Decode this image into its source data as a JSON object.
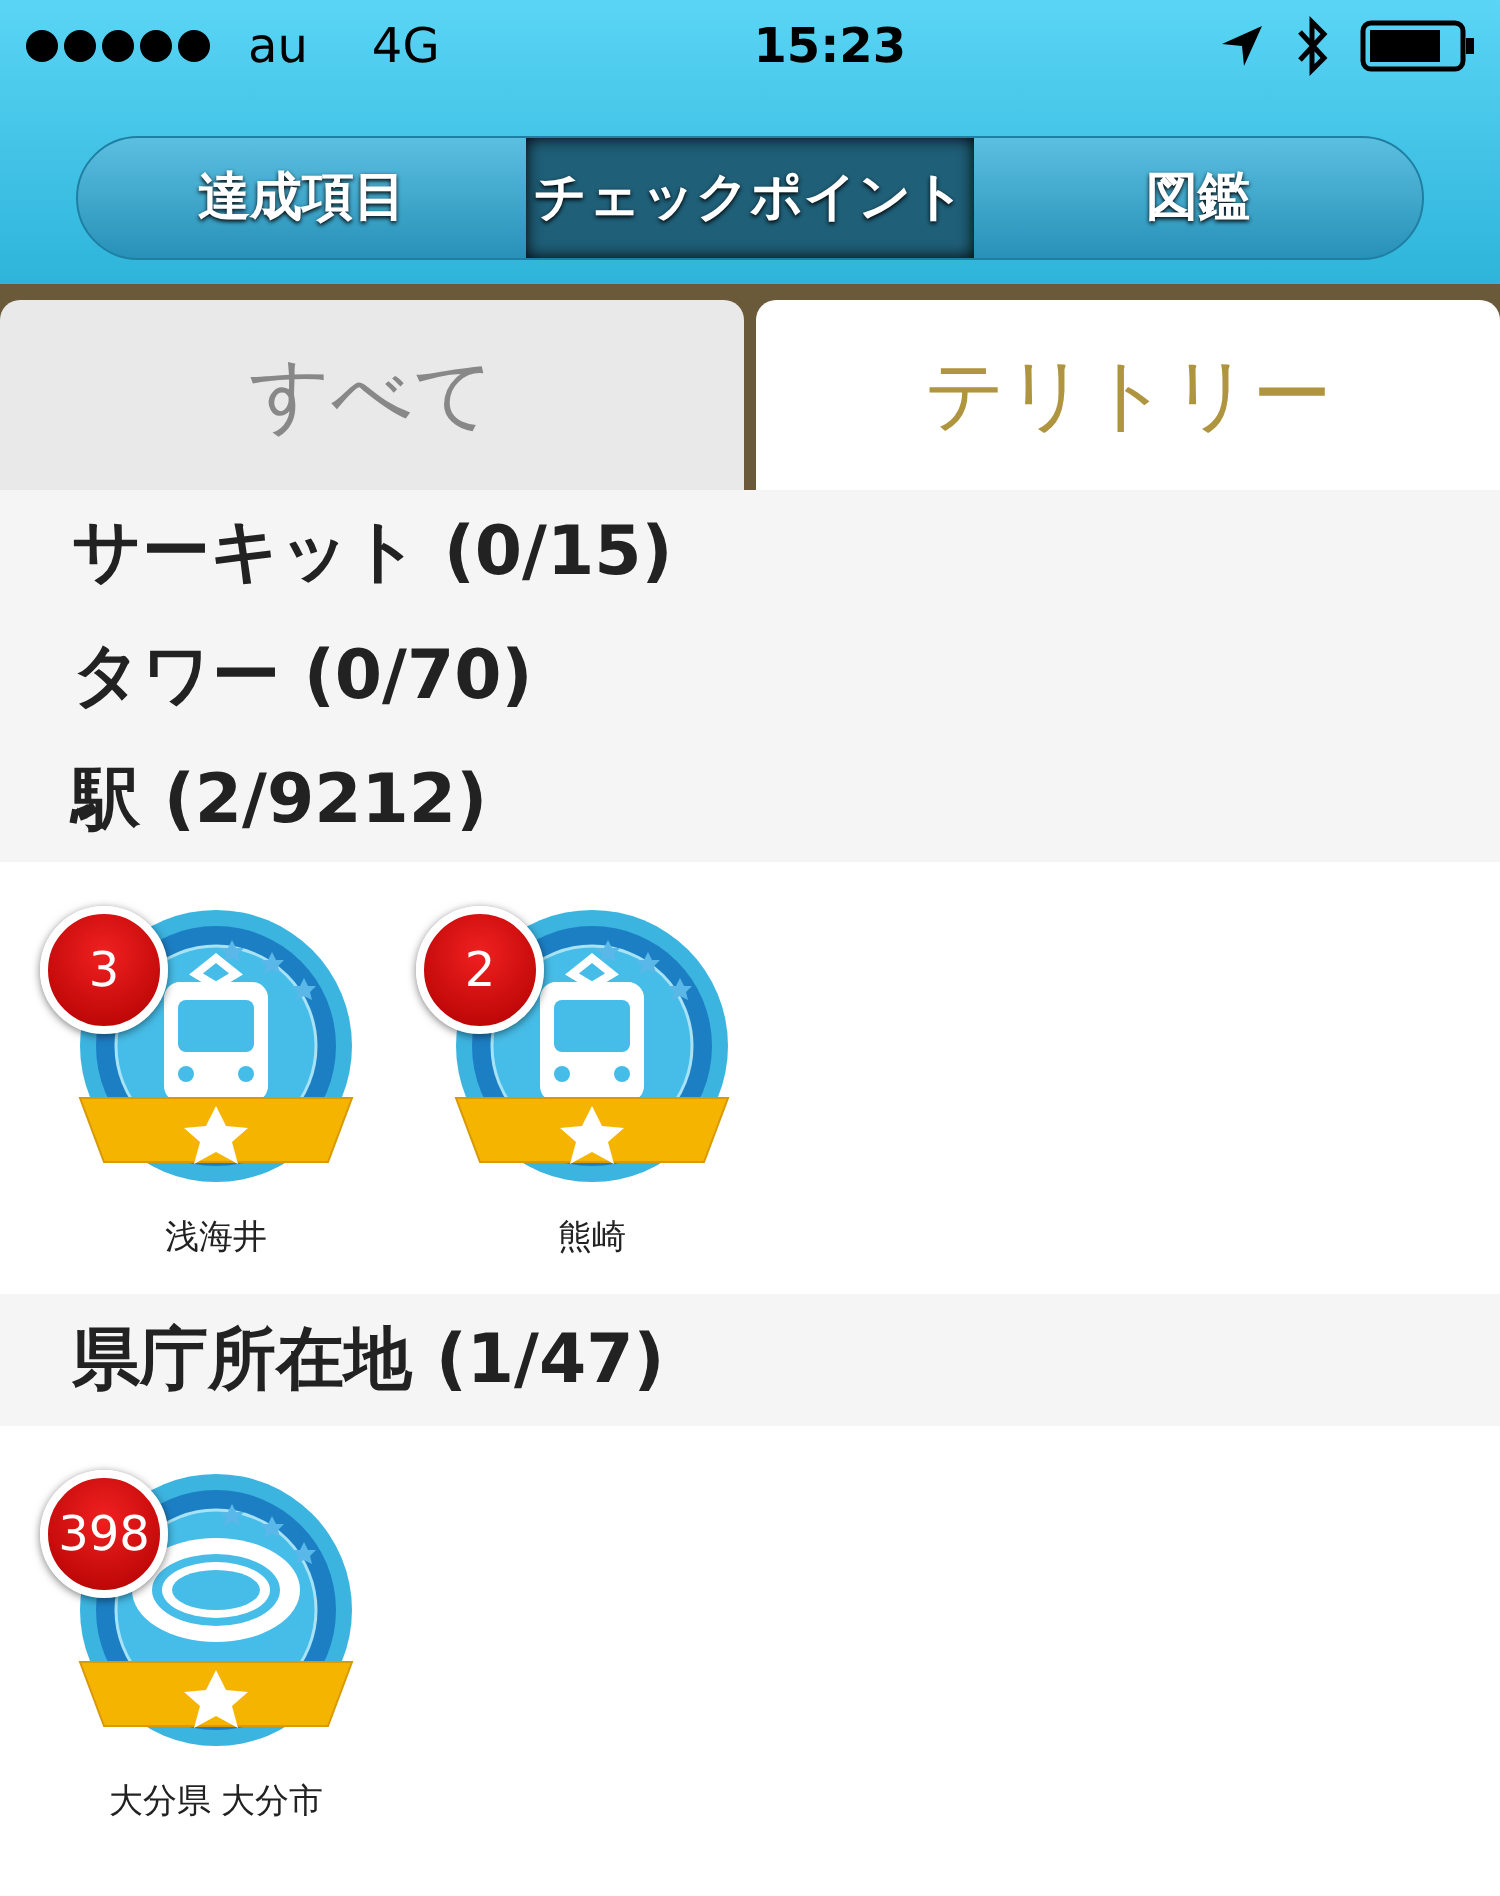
{
  "status_bar": {
    "carrier": "au",
    "network": "4G",
    "time": "15:23"
  },
  "segments": [
    {
      "label": "達成項目",
      "selected": false
    },
    {
      "label": "チェックポイント",
      "selected": true
    },
    {
      "label": "図鑑",
      "selected": false
    }
  ],
  "tabs": [
    {
      "label": "すべて",
      "selected": false
    },
    {
      "label": "テリトリー",
      "selected": true
    }
  ],
  "sections": [
    {
      "title": "サーキット (0/15)"
    },
    {
      "title": "タワー (0/70)"
    },
    {
      "title": "駅 (2/9212)",
      "badges": [
        {
          "kind": "train",
          "count": "3",
          "label": "浅海井"
        },
        {
          "kind": "train",
          "count": "2",
          "label": "熊崎"
        }
      ]
    },
    {
      "title": "県庁所在地 (1/47)",
      "badges": [
        {
          "kind": "capital",
          "count": "398",
          "label": "大分県 大分市"
        }
      ]
    }
  ]
}
